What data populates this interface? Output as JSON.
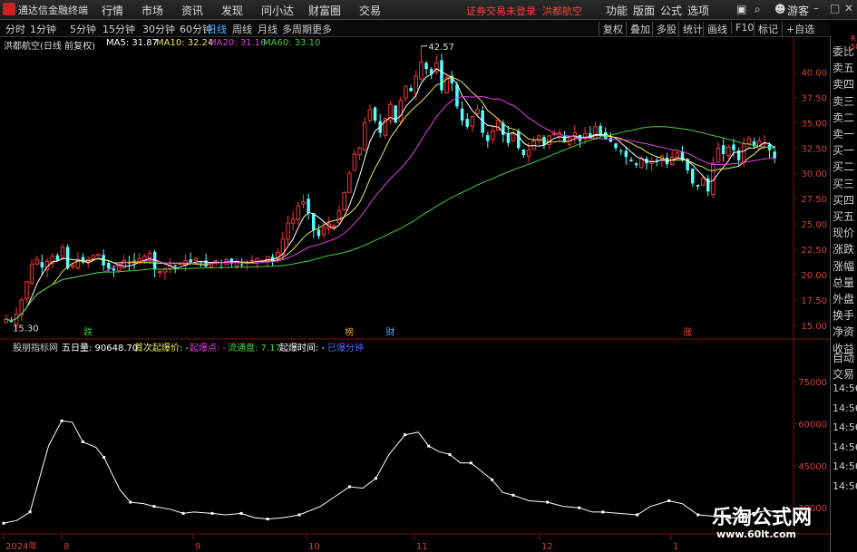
{
  "app": {
    "name": "通达信金融终端",
    "warning": "证券交易未登录",
    "stock": "洪都航空"
  },
  "menu": [
    "行情",
    "市场",
    "资讯",
    "发现",
    "问小达",
    "财富圈",
    "交易"
  ],
  "right_menu": [
    "功能",
    "版面",
    "公式",
    "选项"
  ],
  "guest": "游客",
  "periods": [
    "分时",
    "1分钟",
    "5分钟",
    "15分钟",
    "30分钟",
    "60分钟",
    "日线",
    "周线",
    "月线",
    "多周期",
    "更多"
  ],
  "active_period": "日线",
  "tools": [
    "复权",
    "叠加",
    "多股",
    "统计",
    "画线",
    "F10",
    "标记",
    "+自选"
  ],
  "sidebar": [
    "委比",
    "卖五",
    "卖四",
    "卖三",
    "卖二",
    "卖一",
    "买一",
    "买二",
    "买三",
    "买四",
    "买五",
    "现价",
    "涨跌",
    "涨幅",
    "总量",
    "外盘",
    "换手",
    "净资",
    "收益",
    "自动",
    "交易"
  ],
  "sidebar_top": [
    "R",
    "500"
  ],
  "time_labels": [
    "14:56",
    "14:56",
    "14:56",
    "14:56",
    "14:56",
    "14:56"
  ],
  "legend": {
    "title": "洪都航空(日线 前复权)",
    "ma": [
      {
        "label": "MA5: 31.87",
        "color": "#ffffff"
      },
      {
        "label": "MA10: 32.24",
        "color": "#e8e860"
      },
      {
        "label": "MA20: 31.16",
        "color": "#e040e0"
      },
      {
        "label": "MA60: 33.10",
        "color": "#40d040"
      }
    ]
  },
  "indicator_legend": [
    {
      "text": "股朋指标网",
      "color": "#c8c8c8"
    },
    {
      "text": "五日量: 90648.70",
      "color": "#ffffff"
    },
    {
      "text": "首次起爆价: -",
      "color": "#e8e860"
    },
    {
      "text": "起爆点: -",
      "color": "#e040e0"
    },
    {
      "text": "流通盘: 7.17",
      "color": "#40d040"
    },
    {
      "text": "起爆时间: -",
      "color": "#ffffff"
    },
    {
      "text": "已爆分钟",
      "color": "#4a6aff"
    }
  ],
  "markers": [
    {
      "text": "跌",
      "color": "#40c040"
    },
    {
      "text": "榜",
      "color": "#e0a020"
    },
    {
      "text": "财",
      "color": "#4aa8ff"
    },
    {
      "text": "涨",
      "color": "#ff4040"
    }
  ],
  "watermark": {
    "title": "乐淘公式网",
    "url": "www.60lt.com"
  },
  "chart_data": [
    {
      "type": "candlestick",
      "title": "洪都航空(日线 前复权)",
      "ylim": [
        14,
        43
      ],
      "yticks": [
        15.0,
        17.5,
        20.0,
        22.5,
        25.0,
        27.5,
        30.0,
        32.5,
        35.0,
        37.5,
        40.0
      ],
      "annotations": [
        {
          "text": "42.57",
          "kind": "high"
        },
        {
          "text": "15.30",
          "kind": "low"
        }
      ],
      "x_labels": [
        "2024年",
        "8",
        "9",
        "10",
        "11",
        "12",
        "1"
      ],
      "close": [
        15.6,
        15.3,
        16.1,
        17.5,
        19.3,
        21.0,
        21.5,
        20.7,
        21.3,
        21.8,
        21.4,
        22.7,
        20.6,
        20.9,
        21.5,
        21.2,
        21.5,
        21.9,
        22.0,
        20.9,
        20.6,
        20.4,
        20.8,
        21.4,
        21.1,
        21.2,
        21.6,
        21.8,
        22.1,
        20.5,
        20.3,
        20.6,
        20.9,
        20.8,
        21.1,
        21.4,
        21.2,
        21.6,
        21.2,
        20.8,
        21.2,
        21.4,
        21.2,
        21.5,
        21.1,
        21.3,
        21.0,
        21.2,
        21.4,
        21.6,
        21.4,
        21.8,
        21.3,
        22.2,
        23.5,
        25.1,
        25.5,
        26.8,
        27.2,
        26.1,
        24.4,
        23.8,
        24.6,
        25.0,
        24.8,
        26.3,
        28.1,
        30.0,
        31.9,
        32.5,
        35.0,
        36.3,
        35.2,
        34.0,
        35.4,
        36.8,
        35.0,
        37.2,
        38.6,
        38.1,
        39.6,
        41.0,
        40.3,
        39.8,
        40.9,
        38.2,
        39.5,
        38.9,
        36.6,
        35.2,
        34.6,
        35.6,
        36.3,
        34.0,
        33.2,
        34.2,
        35.2,
        33.8,
        33.0,
        33.9,
        32.5,
        31.8,
        32.3,
        33.2,
        33.7,
        32.8,
        33.7,
        33.9,
        34.0,
        33.1,
        33.5,
        34.0,
        33.2,
        33.9,
        33.5,
        34.6,
        33.8,
        33.4,
        33.1,
        32.5,
        32.2,
        31.6,
        31.2,
        30.8,
        31.5,
        31.0,
        31.2,
        31.3,
        31.7,
        30.9,
        31.6,
        32.0,
        31.3,
        30.3,
        29.0,
        28.7,
        29.5,
        28.2,
        31.0,
        32.5,
        31.9,
        32.6,
        32.3,
        31.3,
        32.9,
        33.4,
        32.7,
        33.2,
        33.0,
        32.3,
        31.5
      ]
    },
    {
      "type": "line",
      "title": "股朋指标网",
      "series": [
        {
          "name": "五日量"
        }
      ],
      "ylim": [
        22000,
        85000
      ],
      "yticks": [
        30000,
        45000,
        60000,
        75000
      ],
      "points": [
        [
          0,
          24500
        ],
        [
          5,
          25500
        ],
        [
          10,
          28500
        ],
        [
          17,
          52000
        ],
        [
          22,
          61000
        ],
        [
          26,
          60500
        ],
        [
          30,
          53500
        ],
        [
          35,
          51500
        ],
        [
          38,
          48000
        ],
        [
          44,
          36500
        ],
        [
          48,
          32000
        ],
        [
          53,
          31500
        ],
        [
          57,
          30500
        ],
        [
          63,
          29500
        ],
        [
          68,
          28000
        ],
        [
          72,
          28500
        ],
        [
          79,
          28000
        ],
        [
          84,
          27500
        ],
        [
          90,
          28000
        ],
        [
          95,
          26500
        ],
        [
          100,
          26000
        ],
        [
          106,
          26500
        ],
        [
          112,
          27500
        ],
        [
          120,
          30500
        ],
        [
          131,
          37500
        ],
        [
          136,
          37000
        ],
        [
          141,
          40500
        ],
        [
          146,
          49000
        ],
        [
          152,
          56000
        ],
        [
          157,
          57000
        ],
        [
          161,
          52000
        ],
        [
          165,
          50000
        ],
        [
          169,
          49000
        ],
        [
          173,
          46000
        ],
        [
          177,
          46000
        ],
        [
          181,
          43000
        ],
        [
          185,
          40000
        ],
        [
          189,
          35500
        ],
        [
          193,
          34500
        ],
        [
          199,
          32500
        ],
        [
          206,
          32000
        ],
        [
          212,
          30500
        ],
        [
          218,
          30000
        ],
        [
          223,
          28500
        ],
        [
          227,
          28500
        ],
        [
          233,
          28000
        ],
        [
          240,
          27500
        ],
        [
          245,
          30500
        ],
        [
          252,
          32500
        ],
        [
          257,
          31500
        ],
        [
          263,
          27500
        ],
        [
          269,
          27000
        ],
        [
          275,
          26500
        ],
        [
          279,
          26500
        ],
        [
          284,
          28000
        ],
        [
          289,
          29000
        ],
        [
          293,
          28500
        ]
      ]
    }
  ]
}
